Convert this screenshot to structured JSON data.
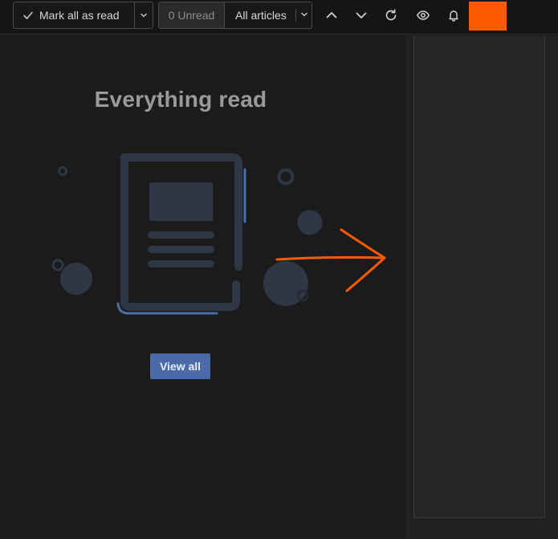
{
  "toolbar": {
    "mark_all_label": "Mark all as read",
    "unread_count_label": "0 Unread",
    "articles_filter_label": "All articles",
    "icons": {
      "mark_check": "check-icon",
      "split_caret": "chevron-down-icon",
      "filter_caret": "chevron-down-icon",
      "previous": "chevron-up-icon",
      "next": "chevron-down-icon",
      "refresh": "refresh-icon",
      "view": "eye-icon",
      "notifications": "bell-icon"
    }
  },
  "empty_state": {
    "title": "Everything read",
    "view_all_label": "View all"
  },
  "colors": {
    "accent": "#ff5a00",
    "primary_button": "#4d6aa8",
    "illustration_stroke": "#2f3646",
    "illustration_accent": "#4b6ea8"
  }
}
